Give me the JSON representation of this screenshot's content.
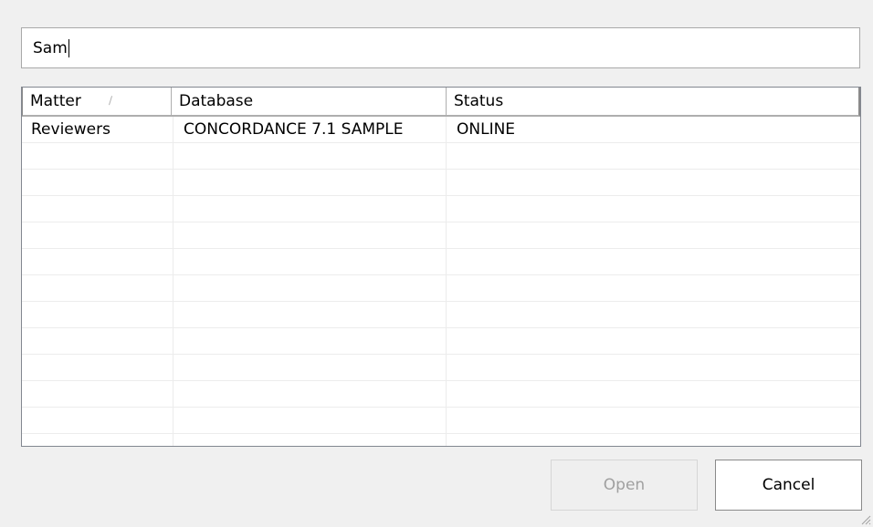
{
  "search": {
    "value": "Sam"
  },
  "grid": {
    "columns": [
      "Matter",
      "Database",
      "Status"
    ],
    "sort_indicator": "∕",
    "rows": [
      {
        "matter": "Reviewers",
        "database": "CONCORDANCE 7.1 SAMPLE",
        "status": "ONLINE"
      }
    ],
    "empty_row_count": 12
  },
  "buttons": {
    "open_label": "Open",
    "cancel_label": "Cancel"
  }
}
